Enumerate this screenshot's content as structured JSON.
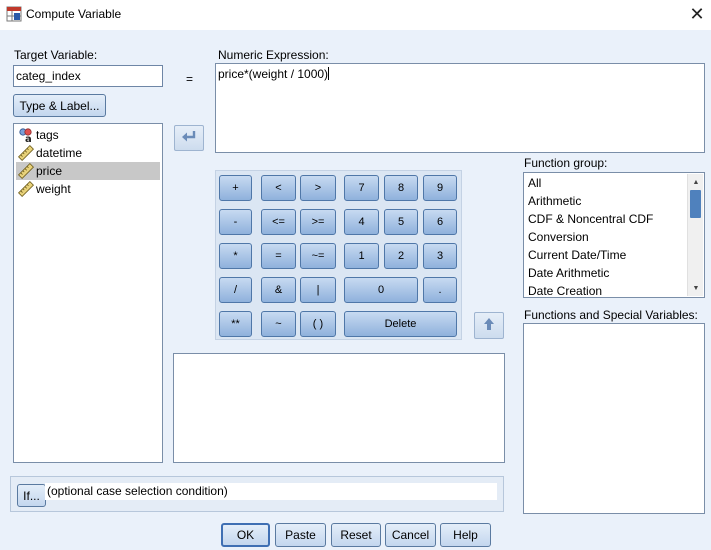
{
  "window": {
    "title": "Compute Variable"
  },
  "target_variable": {
    "label": "Target Variable:",
    "value": "categ_index"
  },
  "equals_sign": "=",
  "type_label_button": "Type & Label...",
  "numeric_expression": {
    "label": "Numeric Expression:",
    "value": "price*(weight / 1000)"
  },
  "variables": [
    {
      "name": "tags",
      "icon": "string-variable-icon",
      "selected": false
    },
    {
      "name": "datetime",
      "icon": "scale-variable-icon",
      "selected": false
    },
    {
      "name": "price",
      "icon": "scale-variable-icon",
      "selected": true
    },
    {
      "name": "weight",
      "icon": "scale-variable-icon",
      "selected": false
    }
  ],
  "keypad": {
    "row1": [
      "+",
      "<",
      ">",
      "7",
      "8",
      "9"
    ],
    "row2": [
      "-",
      "<=",
      ">=",
      "4",
      "5",
      "6"
    ],
    "row3": [
      "*",
      "=",
      "~=",
      "1",
      "2",
      "3"
    ],
    "row4": [
      "/",
      "&",
      "|",
      "0",
      "."
    ],
    "row5": [
      "**",
      "~",
      "( )",
      "Delete"
    ]
  },
  "function_group": {
    "label": "Function group:",
    "items": [
      "All",
      "Arithmetic",
      "CDF & Noncentral CDF",
      "Conversion",
      "Current Date/Time",
      "Date Arithmetic",
      "Date Creation"
    ]
  },
  "functions_special": {
    "label": "Functions and Special Variables:"
  },
  "if_section": {
    "button": "If...",
    "condition_text": "(optional case selection condition)"
  },
  "buttons": {
    "ok": "OK",
    "paste": "Paste",
    "reset": "Reset",
    "cancel": "Cancel",
    "help": "Help"
  },
  "colors": {
    "background": "#eaf1fa",
    "key_face": "#a9c4e6",
    "selection": "#c8c8c8",
    "scroll_thumb": "#4f81bd"
  }
}
